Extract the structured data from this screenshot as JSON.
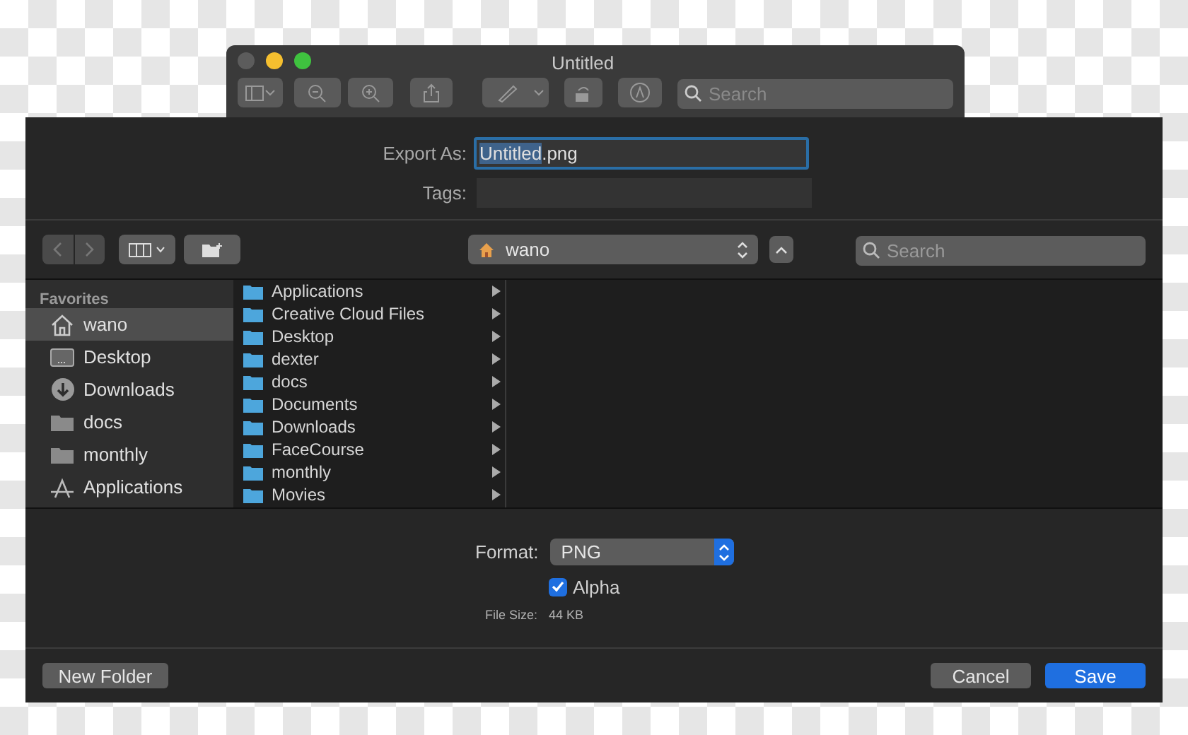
{
  "window": {
    "title": "Untitled"
  },
  "toolbar": {
    "search": {
      "placeholder": "Search"
    }
  },
  "export_as": {
    "label": "Export As:",
    "value_selected": "Untitled",
    "value_rest": ".png"
  },
  "tags": {
    "label": "Tags:"
  },
  "location": {
    "folder": "wano"
  },
  "browser_search": {
    "placeholder": "Search"
  },
  "sidebar": {
    "heading": "Favorites",
    "items": [
      {
        "label": "wano",
        "kind": "home",
        "selected": true
      },
      {
        "label": "Desktop",
        "kind": "desktop",
        "selected": false
      },
      {
        "label": "Downloads",
        "kind": "download",
        "selected": false
      },
      {
        "label": "docs",
        "kind": "folder",
        "selected": false
      },
      {
        "label": "monthly",
        "kind": "folder",
        "selected": false
      },
      {
        "label": "Applications",
        "kind": "apps",
        "selected": false
      }
    ]
  },
  "column": {
    "items": [
      {
        "label": "Applications"
      },
      {
        "label": "Creative Cloud Files"
      },
      {
        "label": "Desktop"
      },
      {
        "label": "dexter"
      },
      {
        "label": "docs"
      },
      {
        "label": "Documents"
      },
      {
        "label": "Downloads"
      },
      {
        "label": "FaceCourse"
      },
      {
        "label": "monthly"
      },
      {
        "label": "Movies"
      }
    ]
  },
  "format": {
    "label": "Format:",
    "value": "PNG"
  },
  "alpha": {
    "label": "Alpha",
    "checked": true
  },
  "file_size": {
    "label": "File Size:",
    "value": "44 KB"
  },
  "buttons": {
    "new_folder": "New Folder",
    "cancel": "Cancel",
    "save": "Save"
  }
}
